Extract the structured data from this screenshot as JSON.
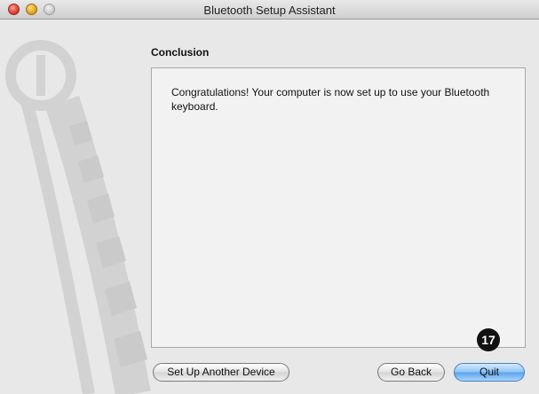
{
  "window": {
    "title": "Bluetooth Setup Assistant"
  },
  "page": {
    "heading": "Conclusion",
    "message": "Congratulations! Your computer is now set up to use your Bluetooth keyboard."
  },
  "buttons": {
    "set_up_another": "Set Up Another Device",
    "go_back": "Go Back",
    "quit": "Quit"
  },
  "callout": {
    "number": "17"
  },
  "colors": {
    "primary_button": "#5aa3ec",
    "window_bg": "#e8e8e8",
    "content_bg": "#f2f2f2"
  },
  "icons": {
    "sidebar_art": "bluetooth-keyboard-watermark-icon"
  }
}
